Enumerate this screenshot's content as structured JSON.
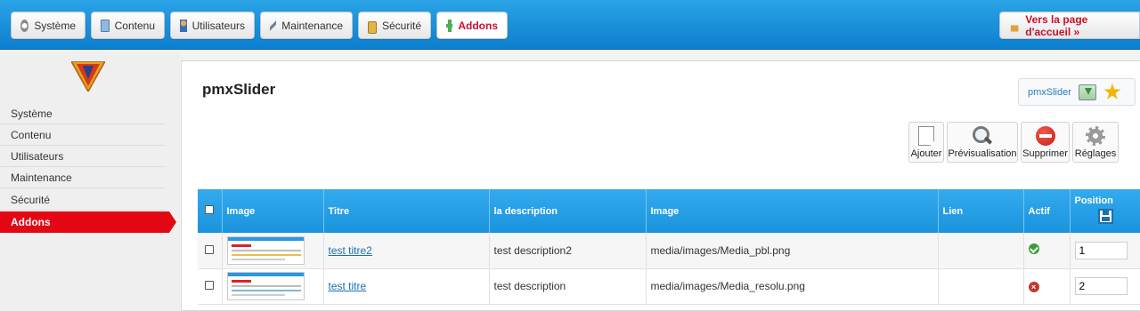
{
  "topnav": {
    "items": [
      {
        "label": "Système",
        "icon": "gear-icon"
      },
      {
        "label": "Contenu",
        "icon": "book-icon"
      },
      {
        "label": "Utilisateurs",
        "icon": "user-icon"
      },
      {
        "label": "Maintenance",
        "icon": "wrench-icon"
      },
      {
        "label": "Sécurité",
        "icon": "lock-icon"
      },
      {
        "label": "Addons",
        "icon": "puzzle-icon",
        "active": true
      }
    ],
    "home_link": "Vers la page d'accueil »"
  },
  "sidebar": {
    "items": [
      {
        "label": "Système"
      },
      {
        "label": "Contenu"
      },
      {
        "label": "Utilisateurs"
      },
      {
        "label": "Maintenance"
      },
      {
        "label": "Sécurité"
      },
      {
        "label": "Addons",
        "active": true
      }
    ]
  },
  "page": {
    "title": "pmxSlider",
    "favorite_label": "pmxSlider"
  },
  "toolbar": {
    "add": "Ajouter",
    "preview": "Prévisualisation",
    "delete": "Supprimer",
    "settings": "Réglages"
  },
  "table": {
    "headers": {
      "image": "Image",
      "title": "Titre",
      "description": "la description",
      "image_path": "Image",
      "link": "Lien",
      "active": "Actif",
      "position": "Position"
    },
    "rows": [
      {
        "title": "test titre2",
        "description": "test description2",
        "image_path": "media/images/Media_pbl.png",
        "link": "",
        "active": true,
        "position": "1"
      },
      {
        "title": "test titre",
        "description": "test description",
        "image_path": "media/images/Media_resolu.png",
        "link": "",
        "active": false,
        "position": "2"
      }
    ]
  },
  "colors": {
    "topbar": "#1a93dd",
    "accent_red": "#e30613",
    "link": "#1a6fb5"
  }
}
